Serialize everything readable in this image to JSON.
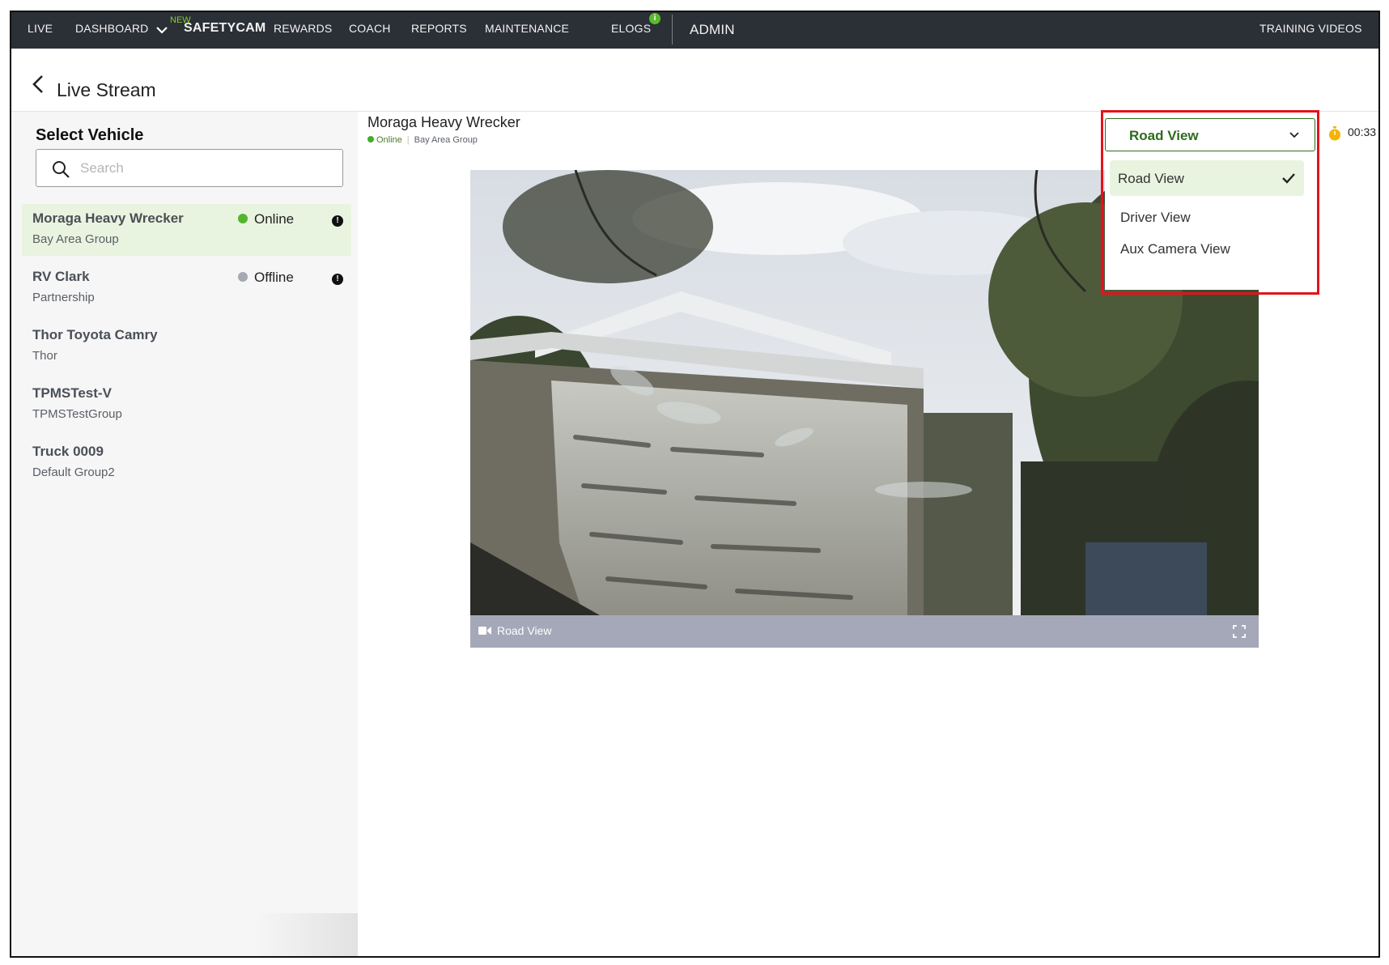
{
  "nav": {
    "live": "LIVE",
    "dashboard": "DASHBOARD",
    "new_badge": "NEW",
    "safetycam": "SAFETYCAM",
    "rewards": "REWARDS",
    "coach": "COACH",
    "reports": "REPORTS",
    "maintenance": "MAINTENANCE",
    "elogs": "ELOGS",
    "elogs_badge": "i",
    "admin": "ADMIN",
    "training_videos": "TRAINING VIDEOS"
  },
  "header": {
    "title": "Live Stream"
  },
  "sidebar": {
    "title": "Select Vehicle",
    "search_placeholder": "Search",
    "vehicles": [
      {
        "name": "Moraga Heavy Wrecker",
        "group": "Bay Area Group",
        "status": "Online",
        "status_color": "#52b52c",
        "active": true
      },
      {
        "name": "RV Clark",
        "group": "Partnership",
        "status": "Offline",
        "status_color": "#a5a9b2",
        "active": false
      },
      {
        "name": "Thor Toyota Camry",
        "group": "Thor"
      },
      {
        "name": "TPMSTest-V",
        "group": "TPMSTestGroup"
      },
      {
        "name": "Truck 0009",
        "group": "Default Group2"
      }
    ]
  },
  "main": {
    "vehicle_title": "Moraga Heavy Wrecker",
    "status": "Online",
    "group": "Bay Area Group",
    "video_label": "Road View",
    "timer": "00:33"
  },
  "view_select": {
    "selected": "Road View",
    "options": [
      "Road View",
      "Driver View",
      "Aux Camera View"
    ]
  },
  "colors": {
    "accent_green": "#2f6b1e",
    "nav_bg": "#2b2f36",
    "highlight_red": "#e3131b"
  }
}
